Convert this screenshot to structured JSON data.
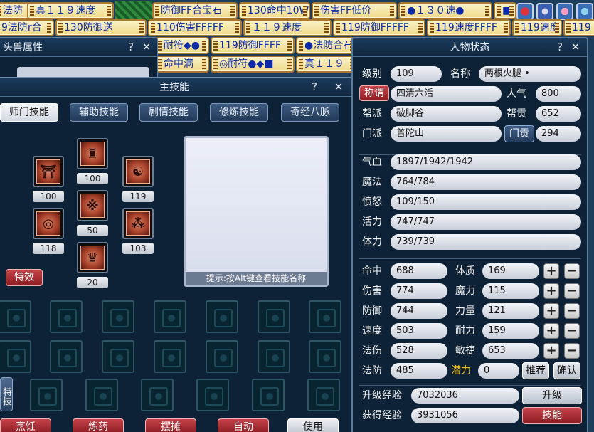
{
  "banners_row1": [
    "法防",
    "真１１９速度",
    "防御FF合宝石",
    "130命中10W",
    "伤害FF低价",
    "●１３０速●",
    "■"
  ],
  "banners_row2": [
    "9法防r合",
    "130防御送",
    "110伤害FFFFF",
    "１１９速度",
    "119防御FFFFF",
    "119速度FFFF",
    "119速度",
    "119"
  ],
  "pet_window": {
    "title": "头兽属性",
    "help": "?",
    "close": "✕"
  },
  "bg_banners": [
    "耐符◆●",
    "119防御FFFF",
    "●法防合石",
    "命中满",
    "◎耐符●◆■",
    "真１１９"
  ],
  "skill_window": {
    "title": "主技能",
    "help": "?",
    "close": "✕",
    "tabs": [
      "师门技能",
      "辅助技能",
      "剧情技能",
      "修炼技能",
      "奇经八脉"
    ],
    "skills": [
      {
        "icon": "pagoda-icon",
        "glyph": "⛩",
        "level": "100"
      },
      {
        "icon": "helmet-icon",
        "glyph": "♜",
        "level": "100"
      },
      {
        "icon": "beast-head-icon",
        "glyph": "☯",
        "level": "119"
      },
      {
        "icon": "seal-ring-icon",
        "glyph": "◎",
        "level": "118"
      },
      {
        "icon": "claw-icon",
        "glyph": "※",
        "level": "50"
      },
      {
        "icon": "spots-icon",
        "glyph": "⁂",
        "level": "103"
      },
      {
        "icon": "crown-icon",
        "glyph": "♛",
        "level": "20"
      }
    ],
    "effect_button": "特效",
    "special_label": "特技",
    "hint": "提示:按Alt键查看技能名称",
    "bottom_buttons": [
      "烹饪",
      "炼药",
      "摆摊",
      "自动",
      "使用"
    ]
  },
  "char_window": {
    "title": "人物状态",
    "help": "?",
    "close": "✕",
    "level_label": "级别",
    "level": "109",
    "name_label": "名称",
    "name": "两根火腿 •",
    "title_button": "称谓",
    "title_value": "四清六活",
    "popularity_label": "人气",
    "popularity": "800",
    "gang_label": "帮派",
    "gang": "破脚谷",
    "gang_contrib_label": "帮贡",
    "gang_contrib": "652",
    "sect_label": "门派",
    "sect": "普陀山",
    "sect_contrib_button": "门贡",
    "sect_contrib": "294",
    "hp_label": "气血",
    "hp": "1897/1942/1942",
    "mp_label": "魔法",
    "mp": "764/784",
    "anger_label": "愤怒",
    "anger": "109/150",
    "vitality_label": "活力",
    "vitality": "747/747",
    "stamina_label": "体力",
    "stamina": "739/739",
    "stats": [
      {
        "label": "命中",
        "value": "688",
        "attr_label": "体质",
        "attr_value": "169"
      },
      {
        "label": "伤害",
        "value": "774",
        "attr_label": "魔力",
        "attr_value": "115"
      },
      {
        "label": "防御",
        "value": "744",
        "attr_label": "力量",
        "attr_value": "121"
      },
      {
        "label": "速度",
        "value": "503",
        "attr_label": "耐力",
        "attr_value": "159"
      },
      {
        "label": "法伤",
        "value": "528",
        "attr_label": "敏捷",
        "attr_value": "653"
      }
    ],
    "mdef_label": "法防",
    "mdef": "485",
    "potential_label": "潜力",
    "potential": "0",
    "recommend_button": "推荐",
    "confirm_button": "确认",
    "upgrade_exp_label": "升级经验",
    "upgrade_exp": "7032036",
    "upgrade_button": "升级",
    "gained_exp_label": "获得经验",
    "gained_exp": "3931056",
    "skills_button": "技能",
    "plus": "+",
    "minus": "−"
  },
  "colors": {
    "potential": "#f0c020",
    "accent_red": "#b32c33",
    "panel": "#0d2236"
  }
}
